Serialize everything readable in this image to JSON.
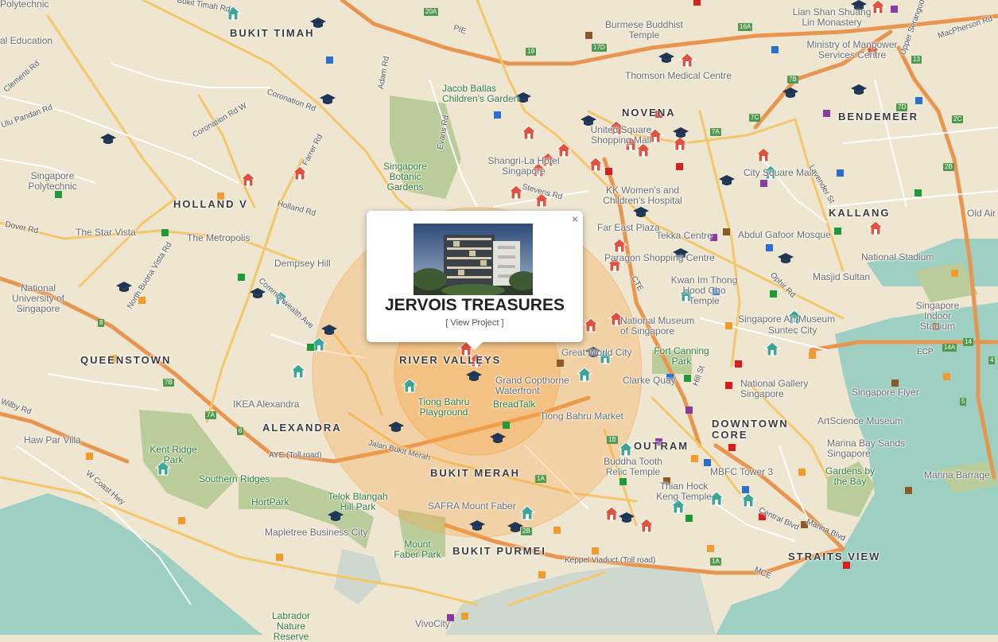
{
  "popup": {
    "title": "JERVOIS TREASURES",
    "link": "[ View Project ]",
    "close": "×"
  },
  "colors": {
    "land": "#efe6d2",
    "park": "#b9cc9a",
    "water": "#9dcfc2",
    "expressway": "#e8964f",
    "major_road": "#f3c76a",
    "radius_fill": "#f6a74a",
    "condo_marker": "#e0523e",
    "school_marker": "#1e3556",
    "landmark_marker": "#3ba598"
  },
  "areas": [
    {
      "text": "BUKIT TIMAH"
    },
    {
      "text": "NOVENA"
    },
    {
      "text": "BENDEMEER"
    },
    {
      "text": "HOLLAND V"
    },
    {
      "text": "KALLANG"
    },
    {
      "text": "QUEENSTOWN"
    },
    {
      "text": "RIVER VALLEYS"
    },
    {
      "text": "ALEXANDRA"
    },
    {
      "text": "DOWNTOWN CORE"
    },
    {
      "text": "OUTRAM"
    },
    {
      "text": "BUKIT MERAH"
    },
    {
      "text": "BUKIT PURMEI"
    },
    {
      "text": "STRAITS VIEW"
    }
  ],
  "places": [
    "Polytechnic",
    "al Education",
    "Singapore Polytechnic",
    "The Star Vista",
    "The Metropolis",
    "Dempsey Hill",
    "National University of Singapore",
    "IKEA Alexandra",
    "Haw Par Villa",
    "Kent Ridge Park",
    "Southern Ridges",
    "HortPark",
    "Telok Blangah Hill Park",
    "Mapletree Business City",
    "SAFRA Mount Faber",
    "Mount Faber Park",
    "Labrador Nature Reserve",
    "VivoCity",
    "Jacob Ballas Children's Garden",
    "Singapore Botanic Gardens",
    "Shangri-La Hotel Singapore",
    "Burmese Buddhist Temple",
    "Thomson Medical Centre",
    "United Square Shopping Mall",
    "KK Women's and Children's Hospital",
    "City Square Mall",
    "Lian Shan Shuang Lin Monastery",
    "Ministry of Manpower Services Centre",
    "Tekka Centre",
    "Abdul Gafoor Mosque",
    "Far East Plaza",
    "Paragon Shopping Centre",
    "Kwan Im Thong Hood Cho Temple",
    "Masjid Sultan",
    "National Stadium",
    "Singapore Indoor Stadium",
    "National Museum of Singapore",
    "Singapore Art Museum",
    "Suntec City",
    "Fort Canning Park",
    "Great World City",
    "Clarke Quay",
    "National Gallery Singapore",
    "Singapore Flyer",
    "ArtScience Museum",
    "Marina Bay Sands Singapore",
    "Gardens by the Bay",
    "Marina Barrage",
    "Grand Copthorne Waterfront",
    "Tiong Bahru Playground",
    "BreadTalk",
    "Tiong Bahru Market",
    "Buddha Tooth Relic Temple",
    "MBFC Tower 3",
    "Thian Hock Keng Temple",
    "Old Air"
  ],
  "roads": [
    "Bukit Timah Rd",
    "PIE",
    "MacPherson Rd",
    "Upper Serangoon Rd",
    "Adam Rd",
    "Evans Rd",
    "Coronation Rd W",
    "Coronation Rd",
    "Farrer Rd",
    "Holland Rd",
    "Dover Rd",
    "North Buona Vista Rd",
    "Commonwealth Ave",
    "Jalan Bukit Merah",
    "AYE (Toll road)",
    "W Coast Hwy",
    "Stevens Rd",
    "Lavender St",
    "Ophir Rd",
    "CTE",
    "Hill St",
    "Central Blvd",
    "Marina Blvd",
    "MCE",
    "ECP",
    "Keppel Viaduct (Toll road)",
    "Clementi Rd",
    "Ulu Pandan Rd",
    "Wilby Rd"
  ],
  "road_shields": [
    "20A",
    "16A",
    "17D",
    "19",
    "7B",
    "7C",
    "2C",
    "2B",
    "7A",
    "7D",
    "13",
    "14",
    "14A",
    "7B",
    "7A",
    "6",
    "8",
    "1A",
    "1B",
    "2B",
    "1A",
    "5",
    "4"
  ]
}
